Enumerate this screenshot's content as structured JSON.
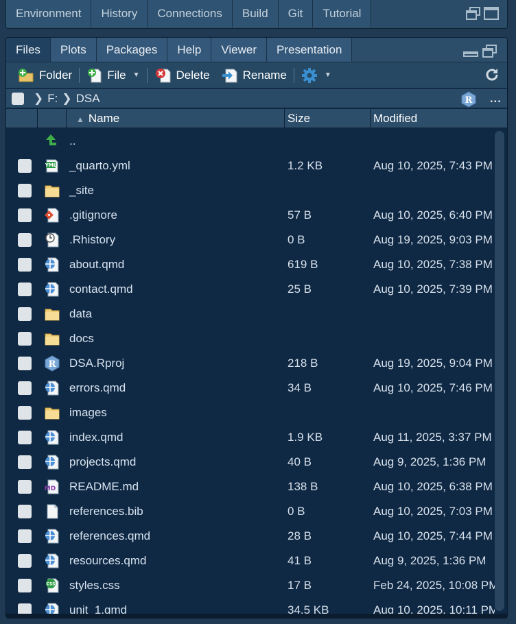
{
  "top_pane": {
    "tabs": [
      "Environment",
      "History",
      "Connections",
      "Build",
      "Git",
      "Tutorial"
    ]
  },
  "files_pane": {
    "tabs": [
      "Files",
      "Plots",
      "Packages",
      "Help",
      "Viewer",
      "Presentation"
    ],
    "active_tab": "Files",
    "toolbar": {
      "folder_label": "Folder",
      "file_label": "File",
      "delete_label": "Delete",
      "rename_label": "Rename"
    },
    "path": {
      "drive": "F:",
      "folder": "DSA"
    },
    "more_label": "...",
    "columns": {
      "name": "Name",
      "size": "Size",
      "modified": "Modified"
    },
    "parent_label": "..",
    "rows": [
      {
        "icon": "yml-file-icon",
        "name": "_quarto.yml",
        "size": "1.2 KB",
        "modified": "Aug 10, 2025, 7:43 PM"
      },
      {
        "icon": "folder-icon",
        "name": "_site",
        "size": "",
        "modified": ""
      },
      {
        "icon": "git-file-icon",
        "name": ".gitignore",
        "size": "57 B",
        "modified": "Aug 10, 2025, 6:40 PM"
      },
      {
        "icon": "history-file-icon",
        "name": ".Rhistory",
        "size": "0 B",
        "modified": "Aug 19, 2025, 9:03 PM"
      },
      {
        "icon": "qmd-file-icon",
        "name": "about.qmd",
        "size": "619 B",
        "modified": "Aug 10, 2025, 7:38 PM"
      },
      {
        "icon": "qmd-file-icon",
        "name": "contact.qmd",
        "size": "25 B",
        "modified": "Aug 10, 2025, 7:39 PM"
      },
      {
        "icon": "folder-icon",
        "name": "data",
        "size": "",
        "modified": ""
      },
      {
        "icon": "folder-icon",
        "name": "docs",
        "size": "",
        "modified": ""
      },
      {
        "icon": "rproj-file-icon",
        "name": "DSA.Rproj",
        "size": "218 B",
        "modified": "Aug 19, 2025, 9:04 PM"
      },
      {
        "icon": "qmd-file-icon",
        "name": "errors.qmd",
        "size": "34 B",
        "modified": "Aug 10, 2025, 7:46 PM"
      },
      {
        "icon": "folder-icon",
        "name": "images",
        "size": "",
        "modified": ""
      },
      {
        "icon": "qmd-file-icon",
        "name": "index.qmd",
        "size": "1.9 KB",
        "modified": "Aug 11, 2025, 3:37 PM"
      },
      {
        "icon": "qmd-file-icon",
        "name": "projects.qmd",
        "size": "40 B",
        "modified": "Aug 9, 2025, 1:36 PM"
      },
      {
        "icon": "md-file-icon",
        "name": "README.md",
        "size": "138 B",
        "modified": "Aug 10, 2025, 6:38 PM"
      },
      {
        "icon": "blank-file-icon",
        "name": "references.bib",
        "size": "0 B",
        "modified": "Aug 10, 2025, 7:03 PM"
      },
      {
        "icon": "qmd-file-icon",
        "name": "references.qmd",
        "size": "28 B",
        "modified": "Aug 10, 2025, 7:44 PM"
      },
      {
        "icon": "qmd-file-icon",
        "name": "resources.qmd",
        "size": "41 B",
        "modified": "Aug 9, 2025, 1:36 PM"
      },
      {
        "icon": "css-file-icon",
        "name": "styles.css",
        "size": "17 B",
        "modified": "Feb 24, 2025, 10:08 PM"
      },
      {
        "icon": "qmd-file-icon",
        "name": "unit_1.qmd",
        "size": "34.5 KB",
        "modified": "Aug 10, 2025, 10:11 PM"
      }
    ]
  }
}
